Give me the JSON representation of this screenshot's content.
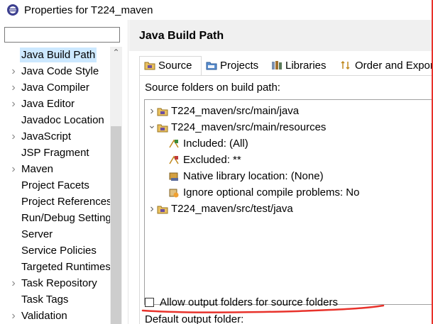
{
  "window": {
    "title": "Properties for T224_maven"
  },
  "filter": {
    "value": "",
    "placeholder": ""
  },
  "left_tree": {
    "items": [
      {
        "label": "Java Build Path",
        "expandable": false,
        "selected": true
      },
      {
        "label": "Java Code Style",
        "expandable": true,
        "selected": false
      },
      {
        "label": "Java Compiler",
        "expandable": true,
        "selected": false
      },
      {
        "label": "Java Editor",
        "expandable": true,
        "selected": false
      },
      {
        "label": "Javadoc Location",
        "expandable": false,
        "selected": false
      },
      {
        "label": "JavaScript",
        "expandable": true,
        "selected": false
      },
      {
        "label": "JSP Fragment",
        "expandable": false,
        "selected": false
      },
      {
        "label": "Maven",
        "expandable": true,
        "selected": false
      },
      {
        "label": "Project Facets",
        "expandable": false,
        "selected": false
      },
      {
        "label": "Project References",
        "expandable": false,
        "selected": false
      },
      {
        "label": "Run/Debug Settings",
        "expandable": false,
        "selected": false
      },
      {
        "label": "Server",
        "expandable": false,
        "selected": false
      },
      {
        "label": "Service Policies",
        "expandable": false,
        "selected": false
      },
      {
        "label": "Targeted Runtimes",
        "expandable": false,
        "selected": false
      },
      {
        "label": "Task Repository",
        "expandable": true,
        "selected": false
      },
      {
        "label": "Task Tags",
        "expandable": false,
        "selected": false
      },
      {
        "label": "Validation",
        "expandable": true,
        "selected": false
      }
    ]
  },
  "page": {
    "title": "Java Build Path",
    "tabs": [
      {
        "label": "Source",
        "icon": "source-folder-icon",
        "active": true
      },
      {
        "label": "Projects",
        "icon": "projects-icon",
        "active": false
      },
      {
        "label": "Libraries",
        "icon": "libraries-icon",
        "active": false
      },
      {
        "label": "Order and Export",
        "icon": "order-export-icon",
        "active": false
      }
    ],
    "source_label": "Source folders on build path:",
    "folders": [
      {
        "label": "T224_maven/src/main/java",
        "level": 0,
        "chevron": ">",
        "icon": "package-folder-icon"
      },
      {
        "label": "T224_maven/src/main/resources",
        "level": 0,
        "chevron": "v",
        "icon": "package-folder-icon"
      },
      {
        "label": "Included: (All)",
        "level": 1,
        "chevron": "",
        "icon": "included-filter-icon"
      },
      {
        "label": "Excluded: **",
        "level": 1,
        "chevron": "",
        "icon": "excluded-filter-icon"
      },
      {
        "label": "Native library location: (None)",
        "level": 1,
        "chevron": "",
        "icon": "native-library-icon"
      },
      {
        "label": "Ignore optional compile problems: No",
        "level": 1,
        "chevron": "",
        "icon": "ignore-problems-icon"
      },
      {
        "label": "T224_maven/src/test/java",
        "level": 0,
        "chevron": ">",
        "icon": "package-folder-icon"
      }
    ],
    "allow_output_label": "Allow output folders for source folders",
    "allow_output_checked": false,
    "default_output_label": "Default output folder:"
  },
  "colors": {
    "selection": "#cce8ff",
    "header_bg": "#f0f0f0",
    "annotation_red": "#e8322b"
  }
}
